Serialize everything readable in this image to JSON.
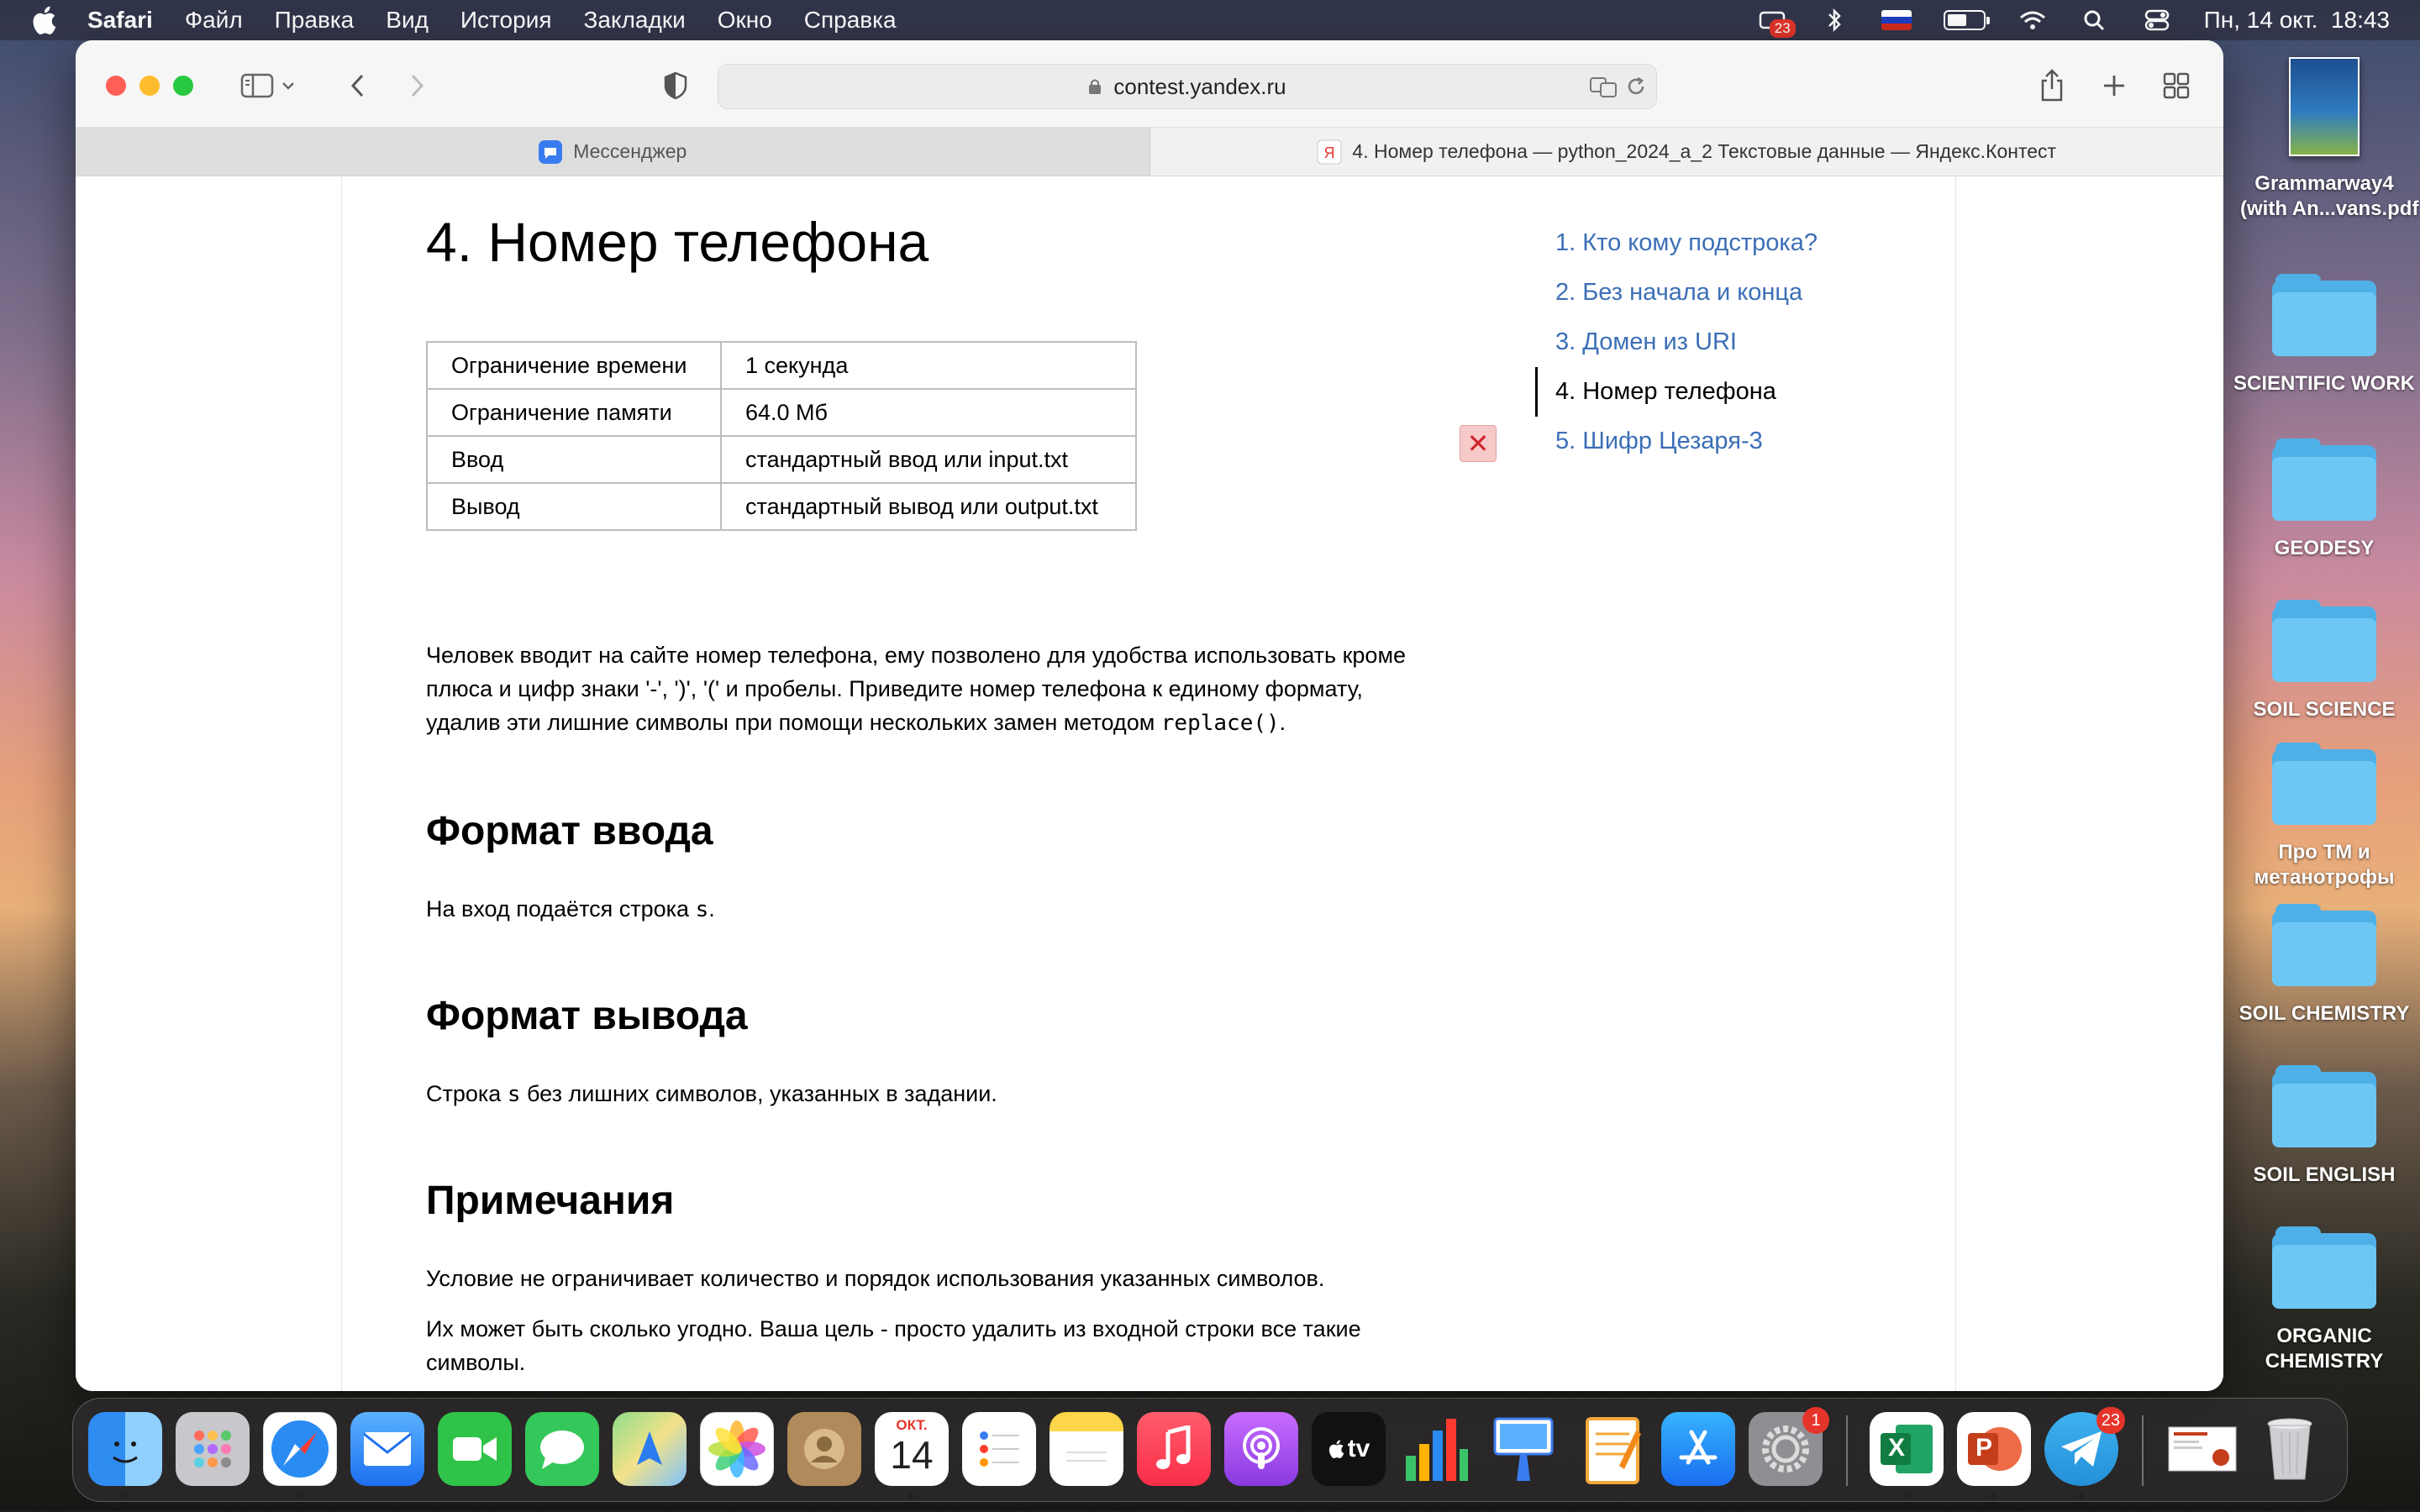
{
  "menubar": {
    "app_name": "Safari",
    "items": [
      "Файл",
      "Правка",
      "Вид",
      "История",
      "Закладки",
      "Окно",
      "Справка"
    ],
    "status_badge": "23",
    "datetime": "Пн, 14 окт.  18:43",
    "battery_level": 0.55
  },
  "browser": {
    "url": "contest.yandex.ru",
    "tabs": [
      {
        "title": "Мессенджер",
        "icon": "messenger-icon",
        "active": false
      },
      {
        "title": "4. Номер телефона — python_2024_a_2 Текстовые данные — Яндекс.Контест",
        "icon": "yandex-icon",
        "active": true
      }
    ]
  },
  "problem": {
    "title": "4. Номер телефона",
    "limits": [
      {
        "key": "Ограничение времени",
        "value": "1 секунда"
      },
      {
        "key": "Ограничение памяти",
        "value": "64.0 Мб"
      },
      {
        "key": "Ввод",
        "value": "стандартный ввод или input.txt"
      },
      {
        "key": "Вывод",
        "value": "стандартный вывод или output.txt"
      }
    ],
    "statement_line1": "Человек вводит на сайте номер телефона, ему позволено для удобства использовать кроме",
    "statement_line2": "плюса и цифр знаки '-', ')', '(' и пробелы. Приведите номер телефона к единому формату,",
    "statement_line3_prefix": "удалив эти лишние символы при помощи нескольких замен методом ",
    "statement_code": "replace()",
    "statement_line3_suffix": ".",
    "input_heading": "Формат ввода",
    "input_text_prefix": "На вход подаётся строка ",
    "input_text_code": "s",
    "input_text_suffix": ".",
    "output_heading": "Формат вывода",
    "output_text_prefix": "Строка ",
    "output_text_code": "s",
    "output_text_suffix": " без лишних символов, указанных в задании.",
    "notes_heading": "Примечания",
    "note1": "Условие не ограничивает количество и порядок использования указанных символов.",
    "note2_line1": "Их может быть сколько угодно. Ваша цель - просто удалить из входной строки все такие",
    "note2_line2": "символы."
  },
  "toc": {
    "items": [
      {
        "label": "1. Кто кому подстрока?"
      },
      {
        "label": "2. Без начала и конца"
      },
      {
        "label": "3. Домен из URI"
      },
      {
        "label": "4. Номер телефона"
      },
      {
        "label": "5. Шифр Цезаря-3"
      }
    ],
    "fail_mark": "✕"
  },
  "desktop": {
    "pdf_label_1": "Grammarway4",
    "pdf_label_2": "(with An...vans.pdf",
    "folders": [
      [
        "SCIENTIFIC WORK"
      ],
      [
        "GEODESY"
      ],
      [
        "SOIL SCIENCE"
      ],
      [
        "Про ТМ и",
        "метанотрофы"
      ],
      [
        "SOIL CHEMISTRY"
      ],
      [
        "SOIL ENGLISH"
      ],
      [
        "ORGANIC",
        "CHEMISTRY"
      ]
    ]
  },
  "dock": {
    "calendar_month": "ОКТ.",
    "calendar_day": "14",
    "settings_badge": "1",
    "telegram_badge": "23",
    "tv_label": "tv",
    "excel_letter": "X",
    "ppt_letter": "P"
  },
  "colors": {
    "link": "#3b6fb6",
    "fail_bg": "#f7c9c9",
    "fail_fg": "#d0242b"
  }
}
